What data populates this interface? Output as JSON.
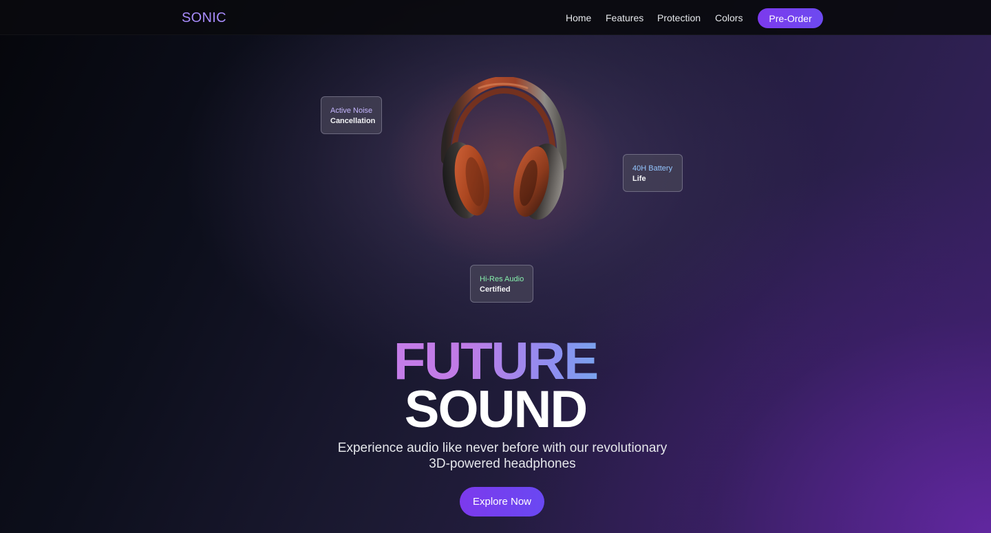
{
  "nav": {
    "logo": "SONIC",
    "links": [
      {
        "label": "Home"
      },
      {
        "label": "Features"
      },
      {
        "label": "Protection"
      },
      {
        "label": "Colors"
      }
    ],
    "cta_label": "Pre-Order"
  },
  "features": {
    "anc": {
      "title": "Active Noise",
      "sub": "Cancellation",
      "color": "#c4b5fd"
    },
    "battery": {
      "title": "40H Battery",
      "sub": "Life",
      "color": "#93c5fd"
    },
    "hires": {
      "title": "Hi-Res Audio",
      "sub": "Certified",
      "color": "#86efac"
    }
  },
  "hero": {
    "title_line1": "FUTURE",
    "title_line2": "SOUND",
    "subtitle": "Experience audio like never before with our revolutionary 3D-powered headphones",
    "cta_label": "Explore Now"
  },
  "media": {
    "product_image": "headphones-icon"
  },
  "colors": {
    "accent": "#7c3aed",
    "logo": "#a78bfa"
  }
}
